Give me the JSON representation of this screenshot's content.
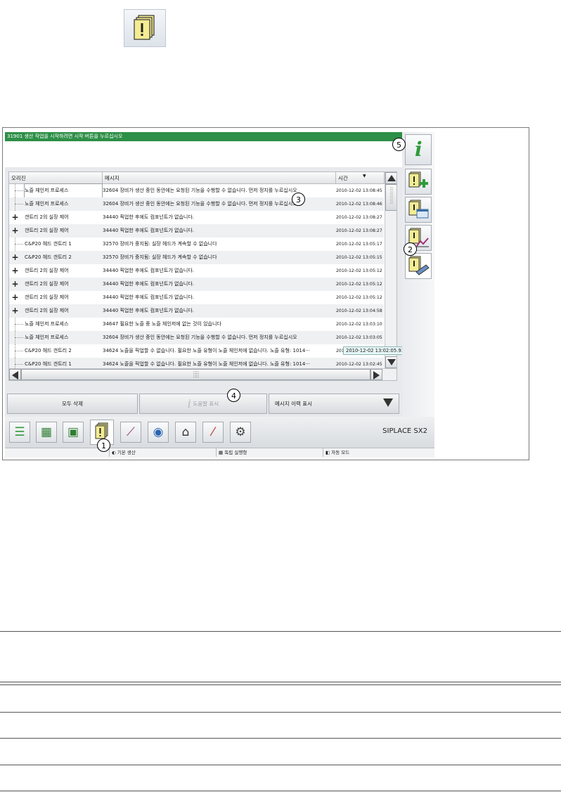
{
  "status_bar": {
    "text": "31901 생산 작업을 시작하려면 시작 버튼을 누르십시오"
  },
  "table": {
    "columns": [
      "오리진",
      "메시지",
      "시간"
    ],
    "rows": [
      {
        "expand": false,
        "origin": "노즐 체인저 프로세스",
        "message": "32604 장비가 생산 중인 동안에는 요청된 기능을 수행할 수 없습니다. 먼저 정지를 누르십시오",
        "time": "2010-12-02 13:08:45"
      },
      {
        "expand": false,
        "origin": "노즐 체인저 프로세스",
        "message": "32604 장비가 생산 중인 동안에는 요청된 기능을 수행할 수 없습니다. 먼저 정지를 누르십시오",
        "time": "2010-12-02 13:08:46"
      },
      {
        "expand": true,
        "origin": "갠트리 2의 실장 제어",
        "message": "34440 픽업한 후에도 컴포넌트가 없습니다.",
        "time": "2010-12-02 13:08:27"
      },
      {
        "expand": true,
        "origin": "갠트리 2의 실장 제어",
        "message": "34440 픽업한 후에도 컴포넌트가 없습니다.",
        "time": "2010-12-02 13:08:27"
      },
      {
        "expand": false,
        "origin": "C&P20 헤드 갠트리 1",
        "message": "32570 장비가 중지됨: 실장 헤드가 계속할 수 없습니다",
        "time": "2010-12-02 13:05:17"
      },
      {
        "expand": true,
        "origin": "C&P20 헤드 갠트리 2",
        "message": "32570 장비가 중지됨: 실장 헤드가 계속할 수 없습니다",
        "time": "2010-12-02 13:05:15"
      },
      {
        "expand": true,
        "origin": "갠트리 2의 실장 제어",
        "message": "34440 픽업한 후에도 컴포넌트가 없습니다.",
        "time": "2010-12-02 13:05:12"
      },
      {
        "expand": true,
        "origin": "갠트리 2의 실장 제어",
        "message": "34440 픽업한 후에도 컴포넌트가 없습니다.",
        "time": "2010-12-02 13:05:12"
      },
      {
        "expand": true,
        "origin": "갠트리 2의 실장 제어",
        "message": "34440 픽업한 후에도 컴포넌트가 없습니다.",
        "time": "2010-12-02 13:05:12"
      },
      {
        "expand": true,
        "origin": "갠트리 2의 실장 제어",
        "message": "34440 픽업한 후에도 컴포넌트가 없습니다.",
        "time": "2010-12-02 13:04:58"
      },
      {
        "expand": false,
        "origin": "노즐 체인저 프로세스",
        "message": "34647 필요한 노즐 중 노즐 체인저에 없는 것이 있습니다",
        "time": "2010-12-02 13:03:10"
      },
      {
        "expand": false,
        "origin": "노즐 체인저 프로세스",
        "message": "32604 장비가 생산 중인 동안에는 요청된 기능을 수행할 수 없습니다. 먼저 정지를 누르십시오",
        "time": "2010-12-02 13:03:05"
      },
      {
        "expand": false,
        "origin": "C&P20 헤드 갠트리 2",
        "message": "34624 노즐을 픽업할 수 없습니다. 필요한 노즐 유형이 노즐 체인저에 없습니다. 노즐 유형: 1014···",
        "time": "2010-12-02 13:02:45"
      },
      {
        "expand": false,
        "origin": "C&P20 헤드 갠트리 1",
        "message": "34624 노즐을 픽업할 수 없습니다. 필요한 노즐 유형이 노즐 체인저에 없습니다. 노즐 유형: 1014···",
        "time": "2010-12-02 13:02:45"
      }
    ],
    "tooltip": "2010-12-02 13:02:05.931"
  },
  "buttons": {
    "delete_all": "모두 삭제",
    "show_help": "도움말 표시",
    "message_history": "메시지 이력 표시"
  },
  "brand": "SIPLACE SX2",
  "footer": {
    "basic_production": "기본 생산",
    "independent_run": "독립 실행형",
    "auto_mode": "자동 모드"
  },
  "callouts": [
    "1",
    "2",
    "3",
    "4",
    "5"
  ],
  "icons": {
    "top": "message-stack-icon",
    "side": [
      "info-icon",
      "add-message-icon",
      "message-window-icon",
      "message-chart-icon",
      "message-edit-icon"
    ],
    "toolbar": [
      "production-stack-icon",
      "grid-icon",
      "setup-icon",
      "messages-icon",
      "chart-icon",
      "camera-icon",
      "feeder-icon",
      "tool-icon",
      "settings-icon"
    ]
  },
  "colors": {
    "status_green": "#2e8f47",
    "accent_green": "#2e9b3a",
    "warning_yellow": "#f1ea8c"
  }
}
